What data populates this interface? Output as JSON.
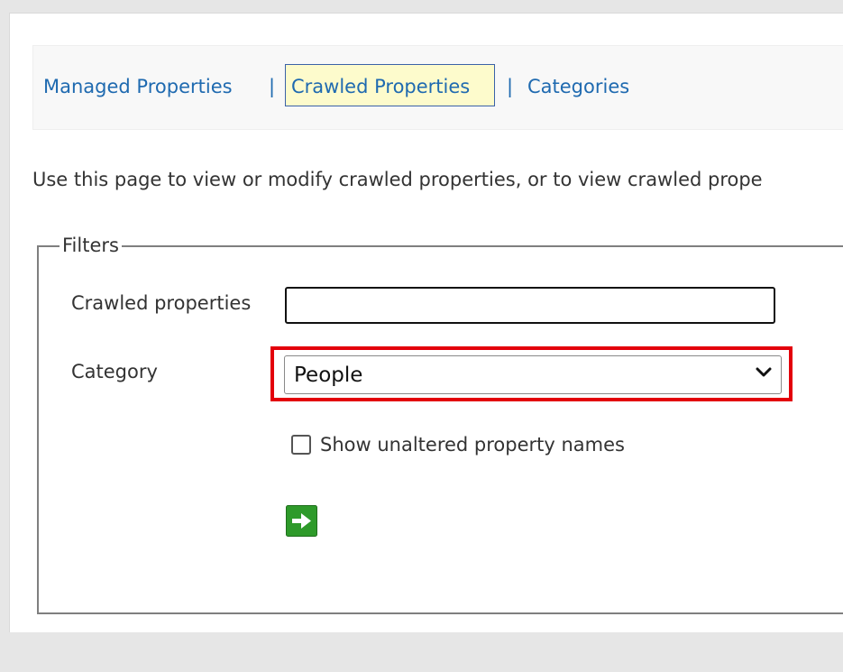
{
  "nav": {
    "managed_label": "Managed Properties",
    "sep1": "|",
    "crawled_label": "Crawled Properties",
    "sep2": "|",
    "categories_label": "Categories"
  },
  "description": "Use this page to view or modify crawled properties, or to view crawled prope",
  "filters": {
    "legend": "Filters",
    "crawled_label": "Crawled properties",
    "crawled_value": "",
    "category_label": "Category",
    "category_value": "People",
    "checkbox_label": "Show unaltered property names",
    "checkbox_checked": false
  },
  "icons": {
    "dropdown": "chevron-down-icon",
    "go": "arrow-right-icon"
  },
  "colors": {
    "link": "#1f6ab0",
    "active_tab_bg": "#fdfbcc",
    "highlight": "#e3000b",
    "go_button": "#2e9a2a"
  }
}
